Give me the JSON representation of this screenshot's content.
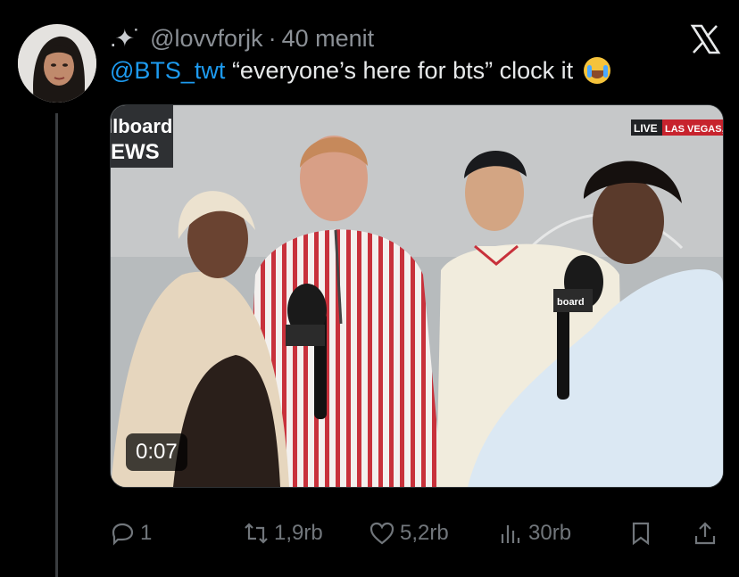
{
  "author": {
    "prefix": ".✦˙",
    "handle": "@lovvforjk",
    "separator": "·",
    "time": "40 menit"
  },
  "tweet": {
    "mention": "@BTS_twt",
    "text": " “everyone’s here for bts” clock it",
    "emoji": "loudly-crying-face"
  },
  "media": {
    "timestamp": "0:07",
    "logo_line1": "llboard",
    "logo_line2": "EWS",
    "live_badge": "LIVE",
    "location_badge": "LAS VEGAS, I",
    "mic_flag": "board"
  },
  "actions": {
    "reply_count": "1",
    "repost_count": "1,9rb",
    "like_count": "5,2rb",
    "views_count": "30rb"
  },
  "colors": {
    "background": "#000000",
    "mention": "#1d9bf0",
    "secondary_text": "#71767b"
  }
}
